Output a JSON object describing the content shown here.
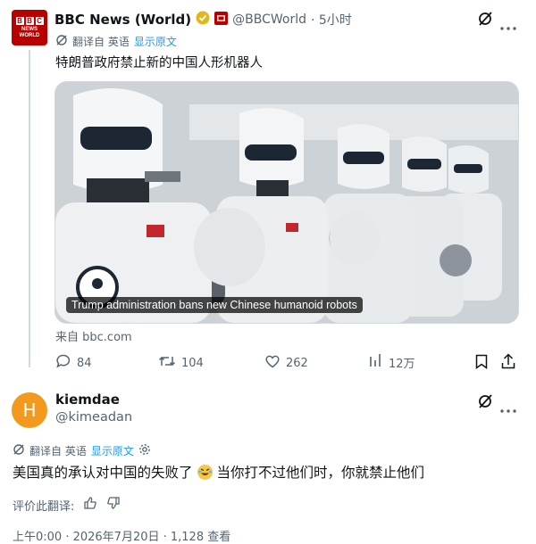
{
  "tweet": {
    "avatar_lines": [
      "B",
      "B",
      "C",
      "NEWS",
      "WORLD"
    ],
    "author_name": "BBC News (World)",
    "author_handle": "@BBCWorld",
    "time": "· 5小时",
    "translate_prefix": "翻译自 英语",
    "show_original": "显示原文",
    "text": "特朗普政府禁止新的中国人形机器人",
    "media_caption": "Trump administration bans new Chinese humanoid robots",
    "source": "来自 bbc.com",
    "stats": {
      "replies": "84",
      "retweets": "104",
      "likes": "262",
      "views": "12万"
    }
  },
  "reply": {
    "avatar_letter": "H",
    "author_name": "kiemdae",
    "author_handle": "@kimeadan",
    "translate_prefix": "翻译自 英语",
    "show_original": "显示原文",
    "text_before": "美国真的承认对中国的失败了",
    "text_after": "当你打不过他们时，你就禁止他们",
    "rate_translation": "评价此翻译:",
    "meta_partial": "上午0:00 · 2026年7月20日 · 1,128 查看"
  },
  "colors": {
    "accent": "#1d9bf0",
    "muted": "#536471",
    "bbc_red": "#b80000",
    "avatar_orange": "#f39a1e"
  },
  "icons": [
    "grok-icon",
    "more-icon",
    "translate-icon",
    "reply-icon",
    "retweet-icon",
    "like-icon",
    "views-icon",
    "bookmark-icon",
    "share-icon",
    "settings-icon",
    "thumbs-up-icon",
    "thumbs-down-icon",
    "verified-badge-icon",
    "bbc-affiliate-icon"
  ]
}
